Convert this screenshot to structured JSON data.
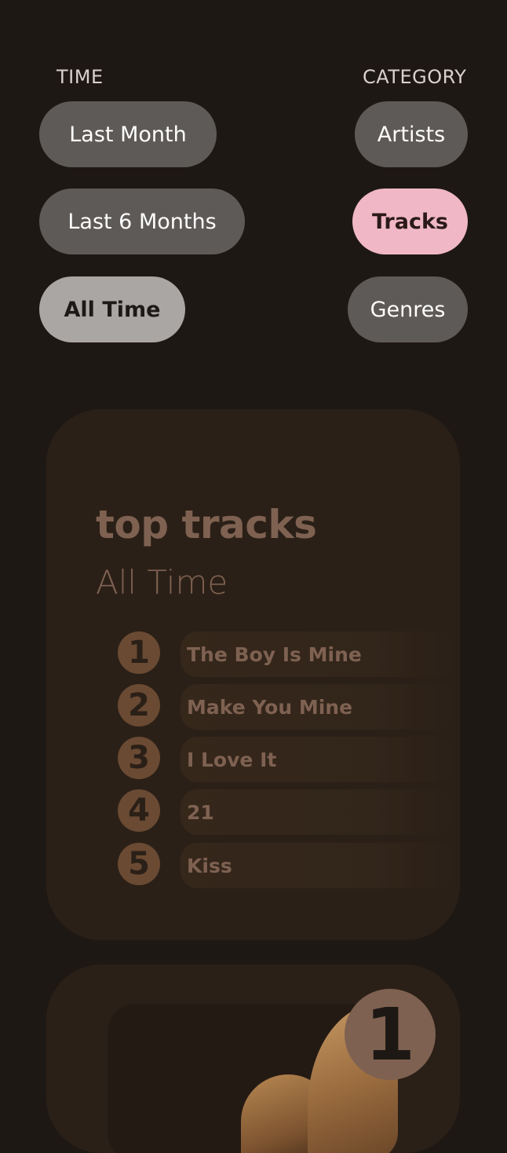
{
  "filters": {
    "time_label": "TIME",
    "category_label": "CATEGORY",
    "time_options": [
      "Last Month",
      "Last 6 Months",
      "All Time"
    ],
    "time_selected": "All Time",
    "category_options": [
      "Artists",
      "Tracks",
      "Genres"
    ],
    "category_selected": "Tracks"
  },
  "top_card": {
    "title": "top tracks",
    "subtitle": "All Time",
    "tracks": [
      {
        "rank": "1",
        "name": "The Boy Is Mine"
      },
      {
        "rank": "2",
        "name": "Make You Mine"
      },
      {
        "rank": "3",
        "name": "I Love It"
      },
      {
        "rank": "4",
        "name": "21"
      },
      {
        "rank": "5",
        "name": "Kiss"
      }
    ]
  },
  "feature_card": {
    "rank": "1"
  },
  "colors": {
    "background": "#1e1814",
    "pill": "#5e5a57",
    "pill_selected_time": "#a9a6a3",
    "pill_selected_category": "#f0b8c6",
    "card": "#2b2017",
    "accent_brown": "#7e6151"
  }
}
